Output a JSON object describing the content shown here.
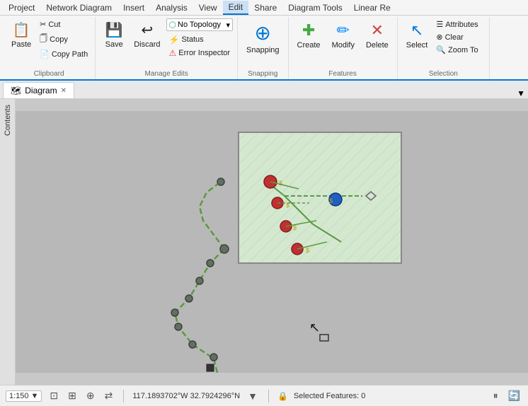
{
  "menu": {
    "items": [
      "Project",
      "Network Diagram",
      "Insert",
      "Analysis",
      "View",
      "Edit",
      "Share",
      "Diagram Tools",
      "Linear Re"
    ]
  },
  "ribbon": {
    "clipboard_group": {
      "label": "Clipboard",
      "paste_label": "Paste",
      "cut_label": "Cut",
      "copy_label": "Copy",
      "copy_path_label": "Copy Path"
    },
    "manage_edits_group": {
      "label": "Manage Edits",
      "save_label": "Save",
      "discard_label": "Discard",
      "topology_label": "No Topology",
      "status_label": "Status",
      "error_inspector_label": "Error Inspector"
    },
    "snapping_group": {
      "label": "Snapping",
      "snapping_label": "Snapping"
    },
    "features_group": {
      "label": "Features",
      "create_label": "Create",
      "modify_label": "Modify",
      "delete_label": "Delete"
    },
    "selection_group": {
      "label": "Selection",
      "select_label": "Select",
      "attributes_label": "Attributes",
      "clear_label": "Clear",
      "zoom_to_label": "Zoom To"
    }
  },
  "tab": {
    "icon": "🗺",
    "label": "Diagram",
    "close_icon": "✕"
  },
  "side_panel": {
    "label": "Contents"
  },
  "status_bar": {
    "scale": "1:150",
    "coordinates": "117.1893702°W 32.7924296°N",
    "selected_features": "Selected Features: 0",
    "dropdown_arrow": "▼"
  }
}
